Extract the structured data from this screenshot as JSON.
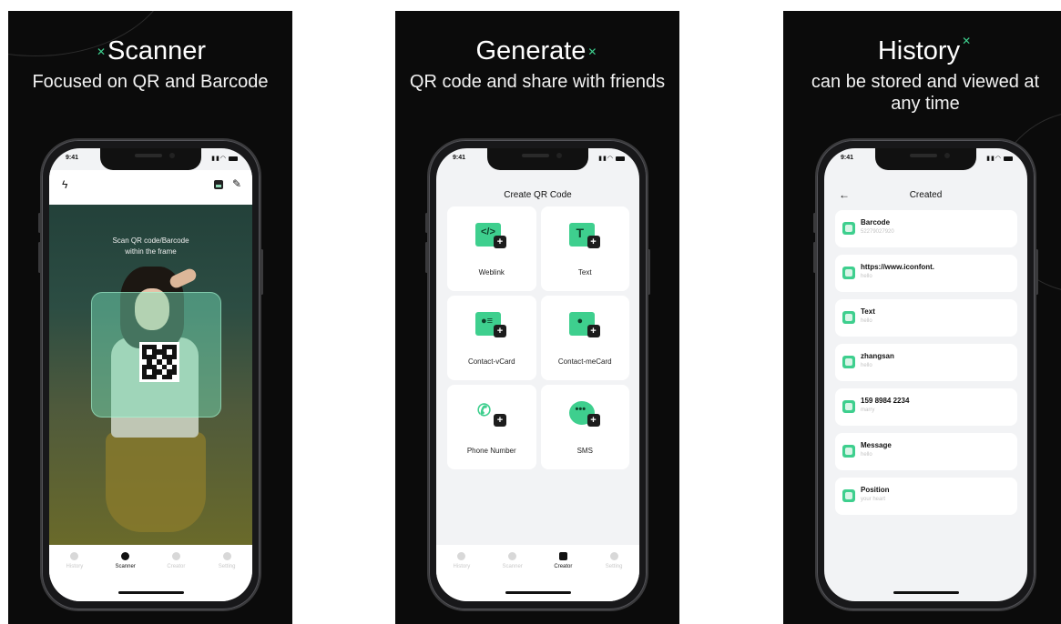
{
  "panels": [
    {
      "headline": "Scanner",
      "subline": "Focused on QR and Barcode",
      "status_time": "9:41",
      "scan_hint_line1": "Scan QR code/Barcode",
      "scan_hint_line2": "within the frame",
      "tabs": [
        "History",
        "Scanner",
        "Creator",
        "Setting"
      ],
      "active_tab": "Scanner"
    },
    {
      "headline": "Generate",
      "subline": "QR code and share with friends",
      "status_time": "9:41",
      "screen_title": "Create QR Code",
      "items": [
        {
          "label": "Weblink",
          "icon": "weblink-icon"
        },
        {
          "label": "Text",
          "icon": "text-icon"
        },
        {
          "label": "Contact-vCard",
          "icon": "vcard-icon"
        },
        {
          "label": "Contact-meCard",
          "icon": "mecard-icon"
        },
        {
          "label": "Phone Number",
          "icon": "phone-icon"
        },
        {
          "label": "SMS",
          "icon": "sms-icon"
        }
      ],
      "tabs": [
        "History",
        "Scanner",
        "Creator",
        "Setting"
      ],
      "active_tab": "Creator"
    },
    {
      "headline": "History",
      "subline": "can be stored and viewed at any time",
      "status_time": "9:41",
      "screen_title": "Created",
      "items": [
        {
          "title": "Barcode",
          "sub": "52279027920"
        },
        {
          "title": "https://www.iconfont.",
          "sub": "hello"
        },
        {
          "title": "Text",
          "sub": "hello"
        },
        {
          "title": "zhangsan",
          "sub": "hello"
        },
        {
          "title": "159 8984 2234",
          "sub": "marry"
        },
        {
          "title": "Message",
          "sub": "hello"
        },
        {
          "title": "Position",
          "sub": "your heart"
        }
      ]
    }
  ],
  "colors": {
    "accent": "#3ecf8e",
    "panel_bg": "#0b0b0b",
    "screen_bg": "#f2f3f5"
  }
}
